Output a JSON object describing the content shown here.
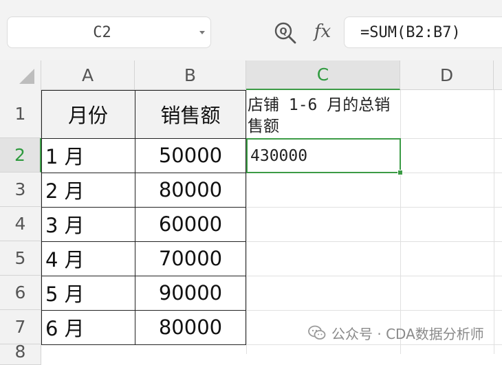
{
  "toolbar": {
    "name_box": "C2",
    "zoom_icon": "zoom-formula-icon",
    "fx_label": "fx",
    "formula": "=SUM(B2:B7)"
  },
  "columns": [
    "A",
    "B",
    "C",
    "D"
  ],
  "active_column": "C",
  "rows": [
    "1",
    "2",
    "3",
    "4",
    "5",
    "6",
    "7",
    "8"
  ],
  "active_row": "2",
  "table": {
    "header": {
      "a": "月份",
      "b": "销售额"
    },
    "rows": [
      {
        "a": "1 月",
        "b": "50000"
      },
      {
        "a": "2 月",
        "b": "80000"
      },
      {
        "a": "3 月",
        "b": "60000"
      },
      {
        "a": "4 月",
        "b": "70000"
      },
      {
        "a": "5 月",
        "b": "90000"
      },
      {
        "a": "6 月",
        "b": "80000"
      }
    ]
  },
  "cells": {
    "c1": "店铺 1-6 月的总销售额",
    "c2": "430000"
  },
  "watermark": "公众号 · CDA数据分析师",
  "colors": {
    "accent_green": "#3b9b45",
    "header_bg": "#f2f2f2",
    "table_border": "#222222"
  }
}
